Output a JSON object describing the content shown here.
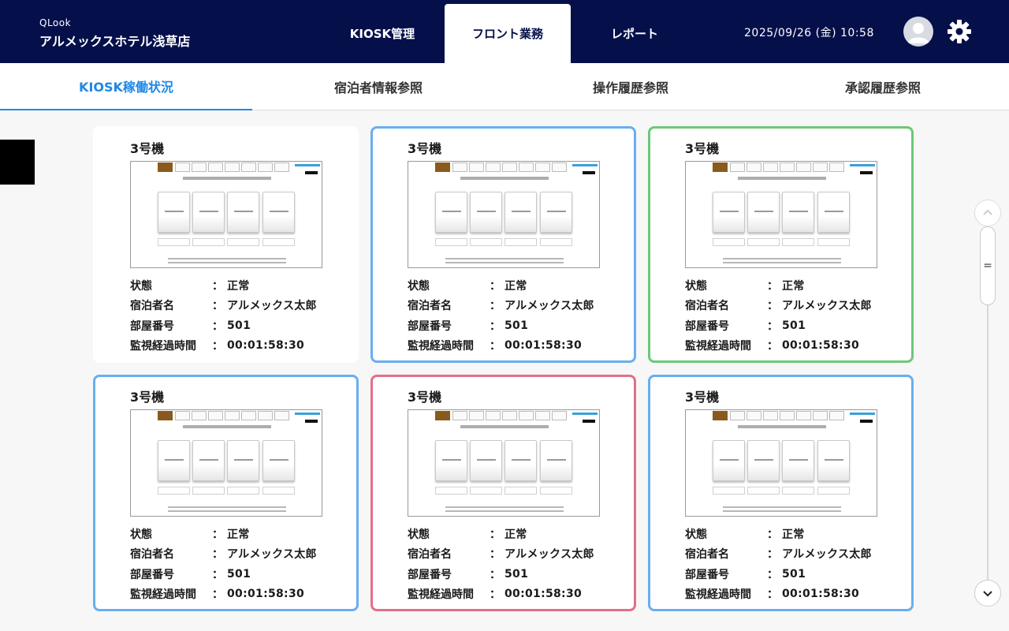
{
  "header": {
    "brand_sub": "QLook",
    "brand_name": "アルメックスホテル浅草店",
    "nav": [
      "KIOSK管理",
      "フロント業務",
      "レポート"
    ],
    "active_nav": "フロント業務",
    "datetime": "2025/09/26 (金) 10:58",
    "avatar_icon": "user-avatar-icon",
    "settings_icon": "gear-icon"
  },
  "subtabs": [
    "KIOSK稼働状況",
    "宿泊者情報参照",
    "操作履歴参照",
    "承認履歴参照"
  ],
  "active_subtab": "KIOSK稼働状況",
  "labels": {
    "status": "状態",
    "guest_name": "宿泊者名",
    "room_number": "部屋番号",
    "elapsed": "監視経過時間",
    "colon": "："
  },
  "cards": [
    {
      "title": "3号機",
      "status": "正常",
      "guest_name": "アルメックス太郎",
      "room_number": "501",
      "elapsed": "00:01:58:30",
      "border": "none"
    },
    {
      "title": "3号機",
      "status": "正常",
      "guest_name": "アルメックス太郎",
      "room_number": "501",
      "elapsed": "00:01:58:30",
      "border": "#6aaef0"
    },
    {
      "title": "3号機",
      "status": "正常",
      "guest_name": "アルメックス太郎",
      "room_number": "501",
      "elapsed": "00:01:58:30",
      "border": "#6cc878"
    },
    {
      "title": "3号機",
      "status": "正常",
      "guest_name": "アルメックス太郎",
      "room_number": "501",
      "elapsed": "00:01:58:30",
      "border": "#6aaef0"
    },
    {
      "title": "3号機",
      "status": "正常",
      "guest_name": "アルメックス太郎",
      "room_number": "501",
      "elapsed": "00:01:58:30",
      "border": "#e36f87"
    },
    {
      "title": "3号機",
      "status": "正常",
      "guest_name": "アルメックス太郎",
      "room_number": "501",
      "elapsed": "00:01:58:30",
      "border": "#6aaef0"
    }
  ],
  "scrollbar": {
    "up_icon": "chevron-up-icon",
    "down_icon": "chevron-down-icon",
    "thumb_glyph": "="
  },
  "colors": {
    "header_bg": "#05104a",
    "accent": "#1e88e5"
  }
}
